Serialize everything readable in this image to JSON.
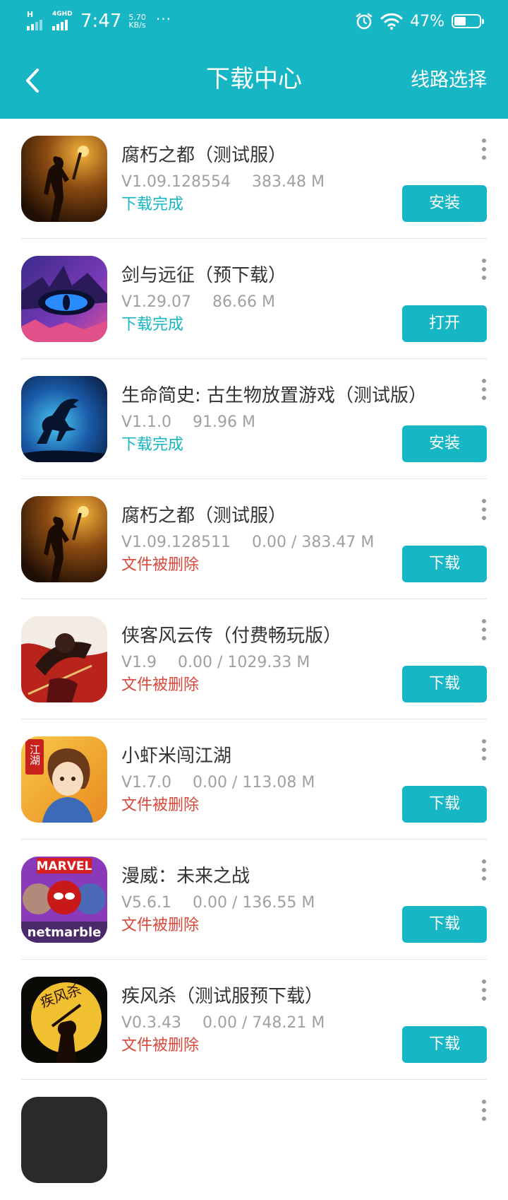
{
  "status_bar": {
    "network_tag_1": "H",
    "network_tag_2": "4GHD",
    "time": "7:47",
    "speed_value": "5.70",
    "speed_unit": "KB/s",
    "dots": "···",
    "battery_percent": "47%",
    "battery_level": 0.47
  },
  "header": {
    "back_icon": "chevron-left-icon",
    "title": "下载中心",
    "route_label": "线路选择"
  },
  "colors": {
    "accent": "#17b6c4",
    "error": "#d9483b",
    "meta": "#a0a0a0"
  },
  "items": [
    {
      "name": "腐朽之都（测试服）",
      "version": "V1.09.128554",
      "size": "383.48 M",
      "status": "下载完成",
      "status_type": "ok",
      "action": "安装",
      "icon": "torch-girl-icon"
    },
    {
      "name": "剑与远征（预下载）",
      "version": "V1.29.07",
      "size": "86.66 M",
      "status": "下载完成",
      "status_type": "ok",
      "action": "打开",
      "icon": "dragon-eye-icon"
    },
    {
      "name": "生命简史: 古生物放置游戏（测试版）",
      "version": "V1.1.0",
      "size": "91.96 M",
      "status": "下载完成",
      "status_type": "ok",
      "action": "安装",
      "icon": "dinosaur-icon"
    },
    {
      "name": "腐朽之都（测试服）",
      "version": "V1.09.128511",
      "size": "0.00 / 383.47 M",
      "status": "文件被删除",
      "status_type": "err",
      "action": "下载",
      "icon": "torch-girl-icon"
    },
    {
      "name": "侠客风云传（付费畅玩版）",
      "version": "V1.9",
      "size": "0.00 / 1029.33 M",
      "status": "文件被删除",
      "status_type": "err",
      "action": "下载",
      "icon": "swordsman-icon"
    },
    {
      "name": "小虾米闯江湖",
      "version": "V1.7.0",
      "size": "0.00 / 113.08 M",
      "status": "文件被删除",
      "status_type": "err",
      "action": "下载",
      "icon": "hero-boy-icon",
      "icon_text": "江湖"
    },
    {
      "name": "漫威：未来之战",
      "version": "V5.6.1",
      "size": "0.00 / 136.55 M",
      "status": "文件被删除",
      "status_type": "err",
      "action": "下载",
      "icon": "marvel-icon",
      "icon_text_top": "MARVEL",
      "icon_text_bottom": "netmarble"
    },
    {
      "name": "疾风杀（测试服预下载）",
      "version": "V0.3.43",
      "size": "0.00 / 748.21 M",
      "status": "文件被删除",
      "status_type": "err",
      "action": "下载",
      "icon": "moon-warrior-icon",
      "icon_text": "疾风杀"
    }
  ]
}
